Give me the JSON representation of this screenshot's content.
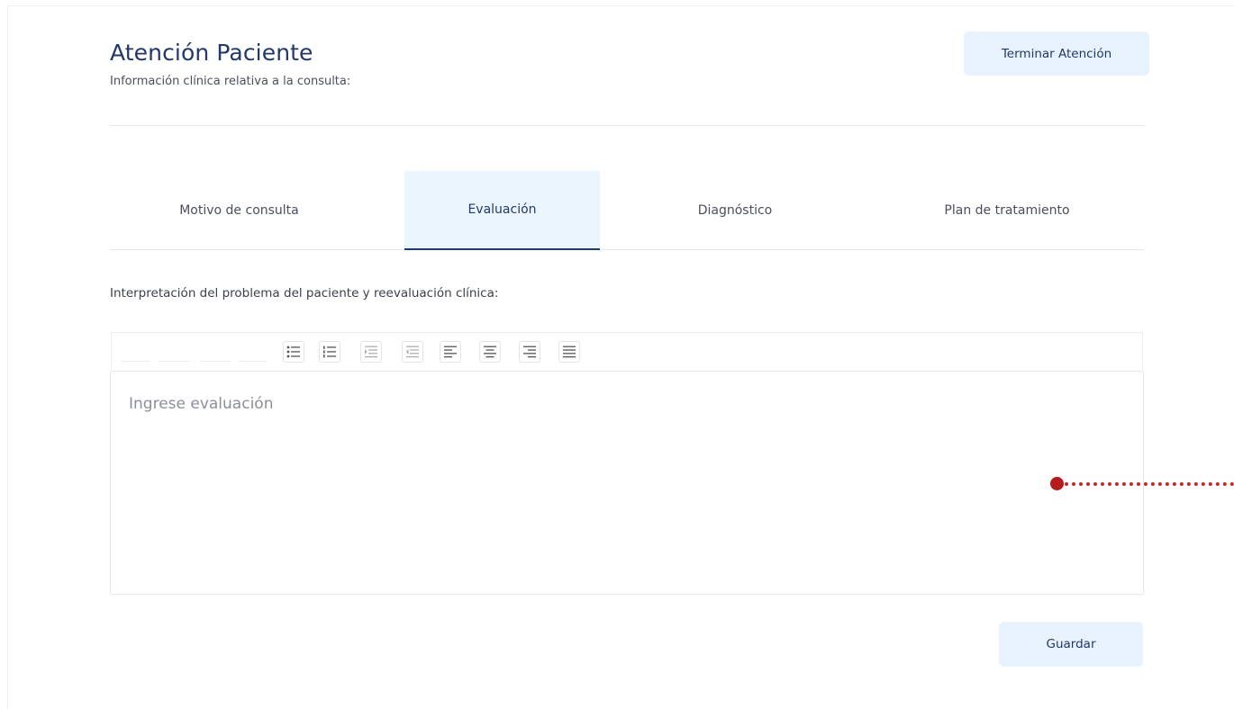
{
  "header": {
    "title": "Atención Paciente",
    "subtitle": "Información clínica relativa a la consulta:",
    "end_button": "Terminar Atención"
  },
  "tabs": [
    {
      "label": "Motivo de consulta",
      "active": false
    },
    {
      "label": "Evaluación",
      "active": true
    },
    {
      "label": "Diagnóstico",
      "active": false
    },
    {
      "label": "Plan de tratamiento",
      "active": false
    }
  ],
  "form": {
    "label": "Interpretación del problema del paciente y reevaluación clínica:",
    "placeholder": "Ingrese evaluación",
    "value": "",
    "save_button": "Guardar"
  },
  "toolbar": {
    "icons": [
      "bullet-list-icon",
      "numbered-list-icon",
      "indent-icon",
      "outdent-icon",
      "align-left-icon",
      "align-center-icon",
      "align-right-icon",
      "align-justify-icon"
    ]
  },
  "colors": {
    "primary": "#22386a",
    "button_bg": "#e8f2fd",
    "active_tab_bg": "#eaf5fd",
    "pointer": "#b71c1c"
  }
}
